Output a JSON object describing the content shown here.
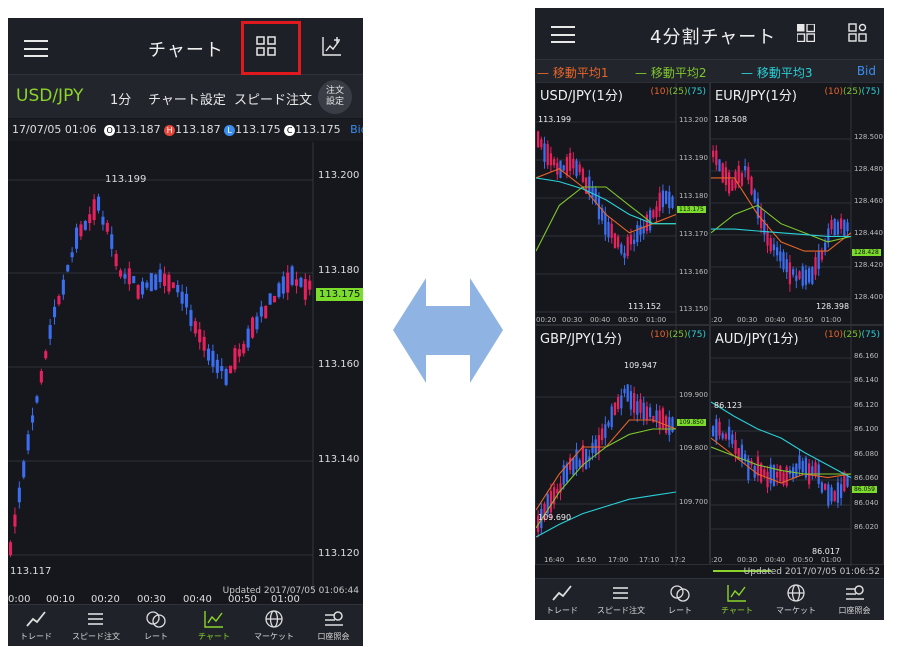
{
  "left": {
    "header_title": "チャート",
    "pair": "USD/JPY",
    "period": "1分",
    "chart_settings": "チャート設定",
    "speed_order": "スピード注文",
    "order_settings_1": "注文",
    "order_settings_2": "設定",
    "ohlc": {
      "datetime": "17/07/05 01:06",
      "open": "113.187",
      "high": "113.187",
      "low": "113.175",
      "close": "113.175",
      "bid": "Bid"
    },
    "price_labels": [
      "113.200",
      "113.180",
      "113.160",
      "113.140",
      "113.120"
    ],
    "current_price": "113.175",
    "high_label": "113.199",
    "low_label": "113.117",
    "time_labels": [
      "0:00",
      "00:10",
      "00:20",
      "00:30",
      "00:40",
      "00:50",
      "01:00"
    ],
    "updated": "Updated  2017/07/05 01:06:44"
  },
  "right": {
    "header_title": "4分割チャート",
    "legend": [
      "移動平均1",
      "移動平均2",
      "移動平均3"
    ],
    "legend_colors": [
      "#e8652a",
      "#7fc72e",
      "#2ad0d8"
    ],
    "bid": "Bid",
    "panes": [
      {
        "pair": "USD/JPY(1分)",
        "ma": [
          "(10)",
          "(25)",
          "(75)"
        ],
        "prices": [
          "113.200",
          "113.190",
          "113.180",
          "113.170",
          "113.160",
          "113.150"
        ],
        "current": "113.175",
        "high": "113.199",
        "low": "113.152",
        "times": [
          "00:20",
          "00:30",
          "00:40",
          "00:50",
          "01:00"
        ]
      },
      {
        "pair": "EUR/JPY(1分)",
        "ma": [
          "(10)",
          "(25)",
          "(75)"
        ],
        "prices": [
          "128.500",
          "128.480",
          "128.460",
          "128.440",
          "128.420",
          "128.400"
        ],
        "current": "128.428",
        "high": "128.508",
        "low": "128.398",
        "times": [
          ":20",
          "00:30",
          "00:40",
          "00:50",
          "01:00"
        ]
      },
      {
        "pair": "GBP/JPY(1分)",
        "ma": [
          "(10)",
          "(25)",
          "(75)"
        ],
        "prices": [
          "109.900",
          "109.800",
          "109.700"
        ],
        "current": "109.850",
        "high": "109.947",
        "low": "109.690",
        "times": [
          "16:40",
          "16:50",
          "17:00",
          "17:10",
          "17:2"
        ]
      },
      {
        "pair": "AUD/JPY(1分)",
        "ma": [
          "(10)",
          "(25)",
          "(75)"
        ],
        "prices": [
          "86.160",
          "86.140",
          "86.120",
          "86.100",
          "86.080",
          "86.060",
          "86.040",
          "86.020"
        ],
        "current": "86.059",
        "high": "86.123",
        "low": "86.017",
        "times": [
          ":20",
          "00:30",
          "00:40",
          "00:50",
          "01:00"
        ]
      }
    ],
    "updated": "Updated  2017/07/05 01:06:52"
  },
  "tabs": [
    "トレード",
    "スピード注文",
    "レート",
    "チャート",
    "マーケット",
    "口座照会"
  ],
  "colors": {
    "bull": "#e8205e",
    "bear": "#3b6ef0",
    "accent": "#8bd42c",
    "arrow": "#8fb4e3",
    "highlight": "#e0191f"
  }
}
